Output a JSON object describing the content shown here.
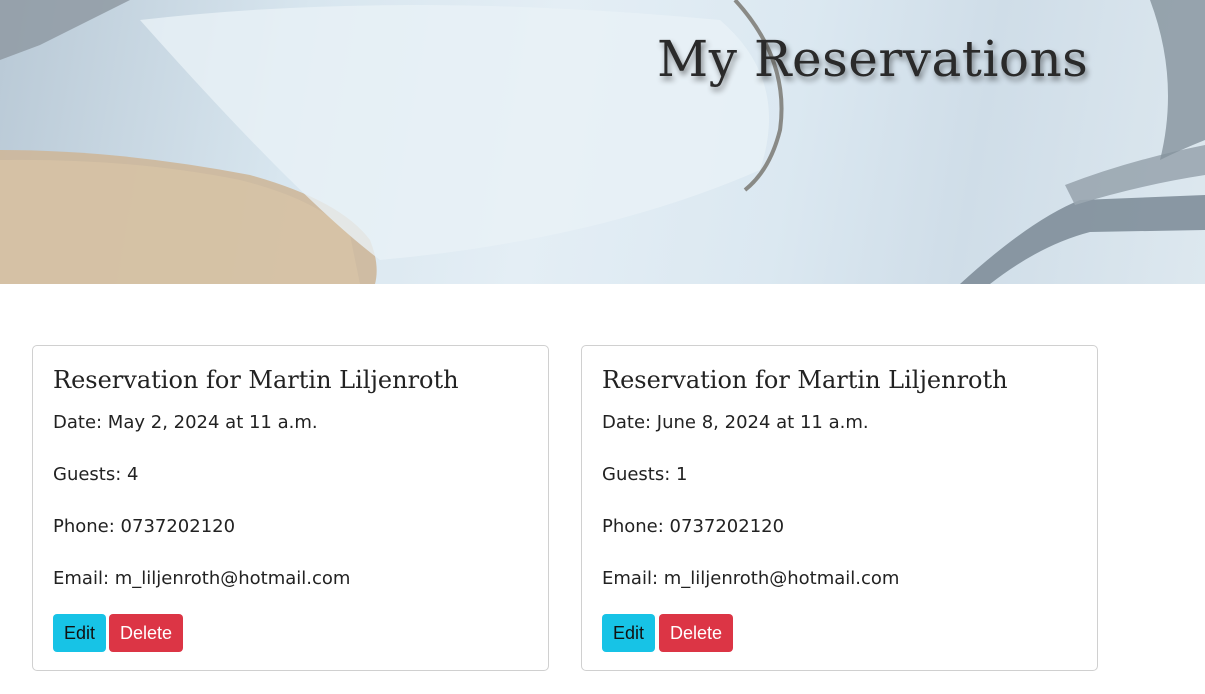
{
  "hero": {
    "title": "My Reservations"
  },
  "reservations": [
    {
      "title": "Reservation for Martin Liljenroth",
      "date": "Date: May 2, 2024 at 11 a.m.",
      "guests": "Guests: 4",
      "phone": "Phone: 0737202120",
      "email": "Email: m_liljenroth@hotmail.com",
      "edit_label": "Edit",
      "delete_label": "Delete"
    },
    {
      "title": "Reservation for Martin Liljenroth",
      "date": "Date: June 8, 2024 at 11 a.m.",
      "guests": "Guests: 1",
      "phone": "Phone: 0737202120",
      "email": "Email: m_liljenroth@hotmail.com",
      "edit_label": "Edit",
      "delete_label": "Delete"
    }
  ],
  "colors": {
    "edit_button": "#17c3e6",
    "delete_button": "#dc3545",
    "card_border": "#d0d0d0"
  }
}
